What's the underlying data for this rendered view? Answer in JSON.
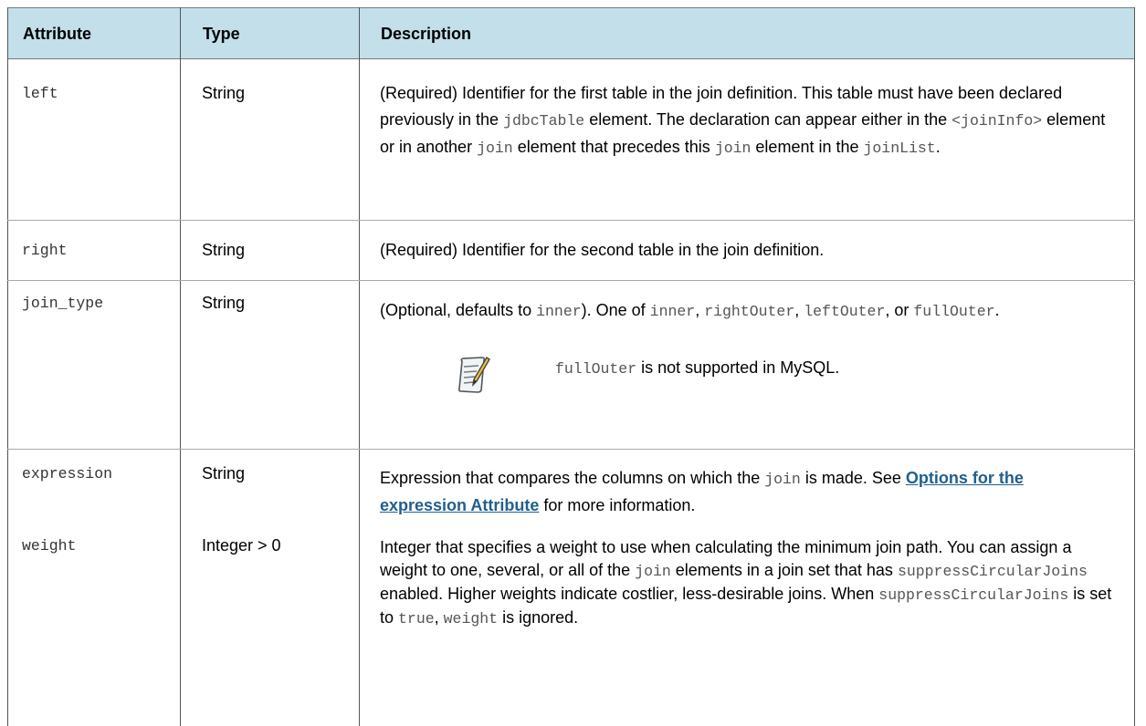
{
  "headers": {
    "attribute": "Attribute",
    "type": "Type",
    "description": "Description"
  },
  "rows": [
    {
      "attribute": "left",
      "type": "String",
      "desc": {
        "t1": "(Required) Identifier for the first table in the join definition. This table must have been declared previously in the ",
        "c1": "jdbcTable",
        "t2": " element. The declaration can appear either in the ",
        "c2": "<joinInfo>",
        "t3": " element or in another ",
        "c3": "join",
        "t4": " element that precedes this ",
        "c4": "join",
        "t5": " element in the ",
        "c5": "joinList",
        "t6": "."
      }
    },
    {
      "attribute": "right",
      "type": "String",
      "desc": {
        "t1": "(Required) Identifier for the second table in the join definition."
      }
    },
    {
      "attribute": "join_type",
      "type": "String",
      "desc": {
        "t1": "(Optional, defaults to ",
        "c1": "inner",
        "t2": "). One of ",
        "c2": "inner",
        "t3": ", ",
        "c3": "rightOuter",
        "t4": ", ",
        "c4": "leftOuter",
        "t5": ", or ",
        "c5": "fullOuter",
        "t6": "."
      },
      "note": {
        "icon": "note-pencil-icon",
        "code": "fullOuter",
        "text": " is not supported in MySQL."
      }
    },
    {
      "attribute": "expression",
      "type": "String",
      "desc": {
        "t1": "Expression that compares the columns on which the ",
        "c1": "join",
        "t2": " is made. See ",
        "link": "Options for the expression Attribute",
        "t3": " for more information."
      }
    },
    {
      "attribute": "weight",
      "type": "Integer > 0",
      "desc": {
        "t1": "Integer that specifies a weight to use when calculating the minimum join path. You can assign a weight to one, several, or all of the ",
        "c1": "join",
        "t2": " elements in a join set that has ",
        "c2": "suppressCircularJoins",
        "t3": " enabled. Higher weights indicate costlier, less-desirable joins. When ",
        "c3": "suppressCircularJoins",
        "t4": " is set to ",
        "c4": "true",
        "t5": ", ",
        "c5": "weight",
        "t6": " is ignored."
      }
    }
  ]
}
